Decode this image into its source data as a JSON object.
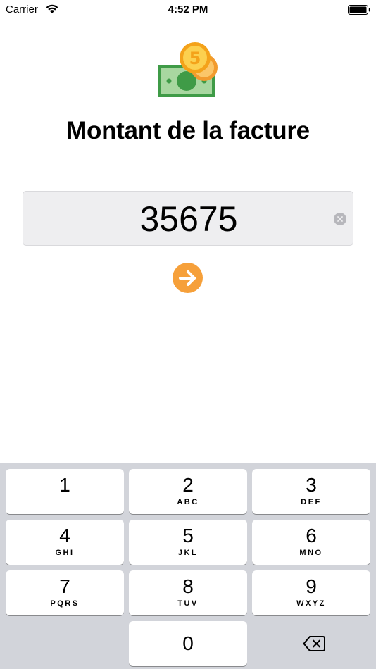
{
  "status_bar": {
    "carrier": "Carrier",
    "time": "4:52 PM"
  },
  "header": {
    "title": "Montant de la facture",
    "illustration_icon": "money-with-coins-icon",
    "coin_label": "5"
  },
  "amount_input": {
    "value": "35675",
    "clear_icon": "clear-circle-icon"
  },
  "submit": {
    "icon": "arrow-right-icon",
    "color": "#f6a03a"
  },
  "keypad": {
    "keys": [
      {
        "digit": "1",
        "letters": ""
      },
      {
        "digit": "2",
        "letters": "ABC"
      },
      {
        "digit": "3",
        "letters": "DEF"
      },
      {
        "digit": "4",
        "letters": "GHI"
      },
      {
        "digit": "5",
        "letters": "JKL"
      },
      {
        "digit": "6",
        "letters": "MNO"
      },
      {
        "digit": "7",
        "letters": "PQRS"
      },
      {
        "digit": "8",
        "letters": "TUV"
      },
      {
        "digit": "9",
        "letters": "WXYZ"
      },
      {
        "digit": "0",
        "letters": ""
      }
    ],
    "delete_icon": "backspace-icon"
  },
  "colors": {
    "accent": "#f6a03a",
    "keyboard_bg": "#d2d4da",
    "field_bg": "#eeeef0",
    "bill_green": "#3f9b47"
  }
}
